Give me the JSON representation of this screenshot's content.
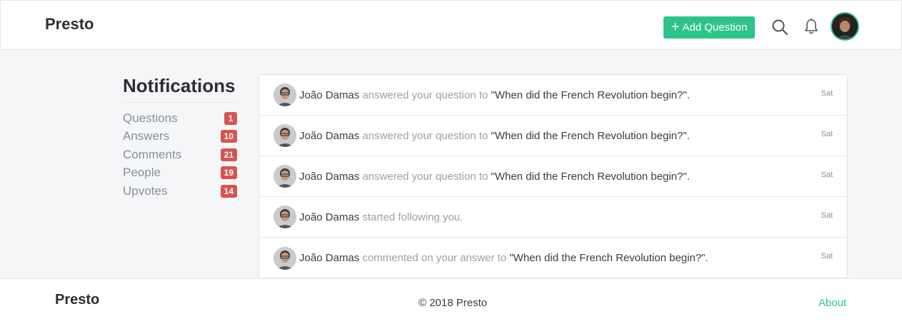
{
  "header": {
    "brand": "Presto",
    "add_question_label": "Add Question",
    "accent_color": "#2fc38c"
  },
  "sidebar": {
    "title": "Notifications",
    "items": [
      {
        "label": "Questions",
        "count": "1"
      },
      {
        "label": "Answers",
        "count": "10"
      },
      {
        "label": "Comments",
        "count": "21"
      },
      {
        "label": "People",
        "count": "19"
      },
      {
        "label": "Upvotes",
        "count": "14"
      }
    ],
    "badge_color": "#d9534f"
  },
  "notifications": [
    {
      "user": "João Damas",
      "action": "answered your question to",
      "target": "\"When did the French Revolution begin?\".",
      "time": "Sat"
    },
    {
      "user": "João Damas",
      "action": "answered your question to",
      "target": "\"When did the French Revolution begin?\".",
      "time": "Sat"
    },
    {
      "user": "João Damas",
      "action": "answered your question to",
      "target": "\"When did the French Revolution begin?\".",
      "time": "Sat"
    },
    {
      "user": "João Damas",
      "action": "started following you.",
      "target": "",
      "time": "Sat"
    },
    {
      "user": "João Damas",
      "action": "commented on your answer to",
      "target": "\"When did the French Revolution begin?\".",
      "time": "Sat"
    }
  ],
  "footer": {
    "brand": "Presto",
    "copyright": "© 2018 Presto",
    "about_label": "About"
  }
}
